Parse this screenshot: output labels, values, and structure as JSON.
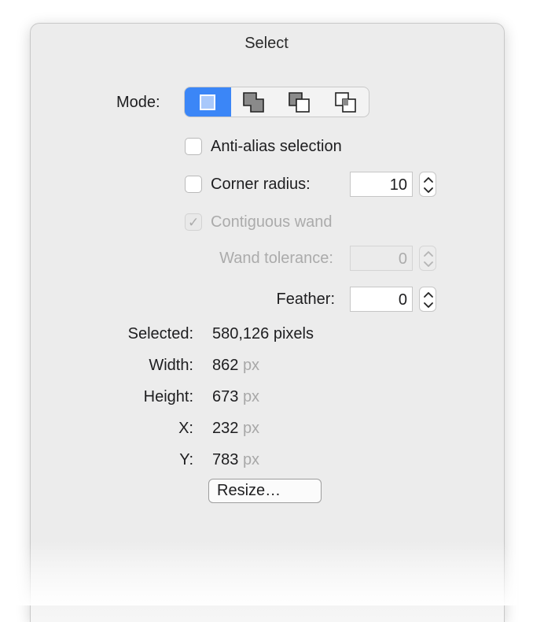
{
  "window": {
    "title": "Select"
  },
  "mode": {
    "label": "Mode:",
    "options": [
      {
        "icon": "new-selection-icon",
        "active": true
      },
      {
        "icon": "add-to-selection-icon",
        "active": false
      },
      {
        "icon": "subtract-from-selection-icon",
        "active": false
      },
      {
        "icon": "intersect-selection-icon",
        "active": false
      }
    ]
  },
  "anti_alias": {
    "label": "Anti-alias selection",
    "checked": false
  },
  "corner_radius": {
    "label": "Corner radius:",
    "checked": false,
    "value": "10"
  },
  "contiguous_wand": {
    "label": "Contiguous wand",
    "checked": true,
    "enabled": false
  },
  "wand_tolerance": {
    "label": "Wand tolerance:",
    "value": "0",
    "enabled": false
  },
  "feather": {
    "label": "Feather:",
    "value": "0"
  },
  "info": {
    "selected_label": "Selected:",
    "selected_value": "580,126 pixels",
    "width_label": "Width:",
    "width_value": "862",
    "height_label": "Height:",
    "height_value": "673",
    "x_label": "X:",
    "x_value": "232",
    "y_label": "Y:",
    "y_value": "783",
    "unit": "px"
  },
  "resize_button": {
    "label": "Resize…"
  },
  "colors": {
    "accent": "#3b86f7",
    "disabled_text": "#ababab"
  }
}
